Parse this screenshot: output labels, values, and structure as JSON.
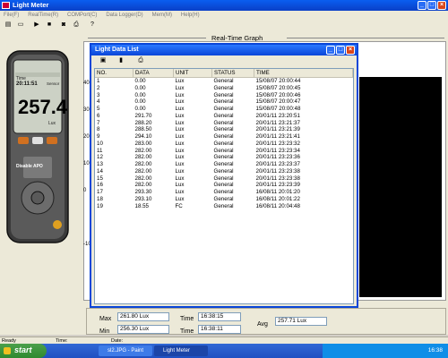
{
  "app": {
    "title": "Light Meter",
    "menu": [
      "File(F)",
      "RealTime(R)",
      "COMPort(C)",
      "Data Logger(D)",
      "Mem(M)",
      "Help(H)"
    ]
  },
  "chart_header": "Real-Time   Graph",
  "chart_y_ticks": [
    "40",
    "30",
    "20",
    "10",
    "0",
    "-10"
  ],
  "meter": {
    "display_label": "Time",
    "time": "20:11:51",
    "mode": "Sensor",
    "reading": "257.4",
    "unit": "Lux",
    "apo_label": "Disable APO"
  },
  "data_list": {
    "title": "Light Data List",
    "columns": [
      "NO.",
      "DATA",
      "UNIT",
      "STATUS",
      "TIME"
    ],
    "rows": [
      [
        "1",
        "0.00",
        "Lux",
        "General",
        "15/08/07 20:00:44"
      ],
      [
        "2",
        "0.00",
        "Lux",
        "General",
        "15/08/07 20:00:45"
      ],
      [
        "3",
        "0.00",
        "Lux",
        "General",
        "15/08/07 20:00:46"
      ],
      [
        "4",
        "0.00",
        "Lux",
        "General",
        "15/08/07 20:00:47"
      ],
      [
        "5",
        "0.00",
        "Lux",
        "General",
        "15/08/07 20:00:48"
      ],
      [
        "6",
        "291.70",
        "Lux",
        "General",
        "20/01/11 23:20:51"
      ],
      [
        "7",
        "288.20",
        "Lux",
        "General",
        "20/01/11 23:21:37"
      ],
      [
        "8",
        "288.50",
        "Lux",
        "General",
        "20/01/11 23:21:39"
      ],
      [
        "9",
        "294.10",
        "Lux",
        "General",
        "20/01/11 23:21:41"
      ],
      [
        "10",
        "283.00",
        "Lux",
        "General",
        "20/01/11 23:23:32"
      ],
      [
        "11",
        "282.00",
        "Lux",
        "General",
        "20/01/11 23:23:34"
      ],
      [
        "12",
        "282.00",
        "Lux",
        "General",
        "20/01/11 23:23:36"
      ],
      [
        "13",
        "282.00",
        "Lux",
        "General",
        "20/01/11 23:23:37"
      ],
      [
        "14",
        "282.00",
        "Lux",
        "General",
        "20/01/11 23:23:38"
      ],
      [
        "15",
        "282.00",
        "Lux",
        "General",
        "20/01/11 23:23:38"
      ],
      [
        "16",
        "282.00",
        "Lux",
        "General",
        "20/01/11 23:23:39"
      ],
      [
        "17",
        "293.30",
        "Lux",
        "General",
        "16/08/11 20:01:20"
      ],
      [
        "18",
        "293.10",
        "Lux",
        "General",
        "16/08/11 20:01:22"
      ],
      [
        "19",
        "18.55",
        "FC",
        "General",
        "16/08/11 20:04:48"
      ]
    ]
  },
  "stats": {
    "max_label": "Max",
    "max_value": "261.80  Lux",
    "min_label": "Min",
    "min_value": "256.30  Lux",
    "time_label": "Time",
    "max_time": "16:38:15",
    "min_time": "16:38:11",
    "avg_label": "Avg",
    "avg_value": "257.71  Lux"
  },
  "statusbar": {
    "ready": "Ready",
    "time": "Time:",
    "date": "Date:"
  },
  "taskbar": {
    "start": "start",
    "tasks": [
      "sl2.JPG - Paint",
      "Light Meter"
    ],
    "clock": "16:38"
  },
  "colors": {
    "titlebar": "#0a46d8",
    "taskbar": "#245edb",
    "start": "#3c9a3c",
    "chart_bg": "#000000"
  }
}
